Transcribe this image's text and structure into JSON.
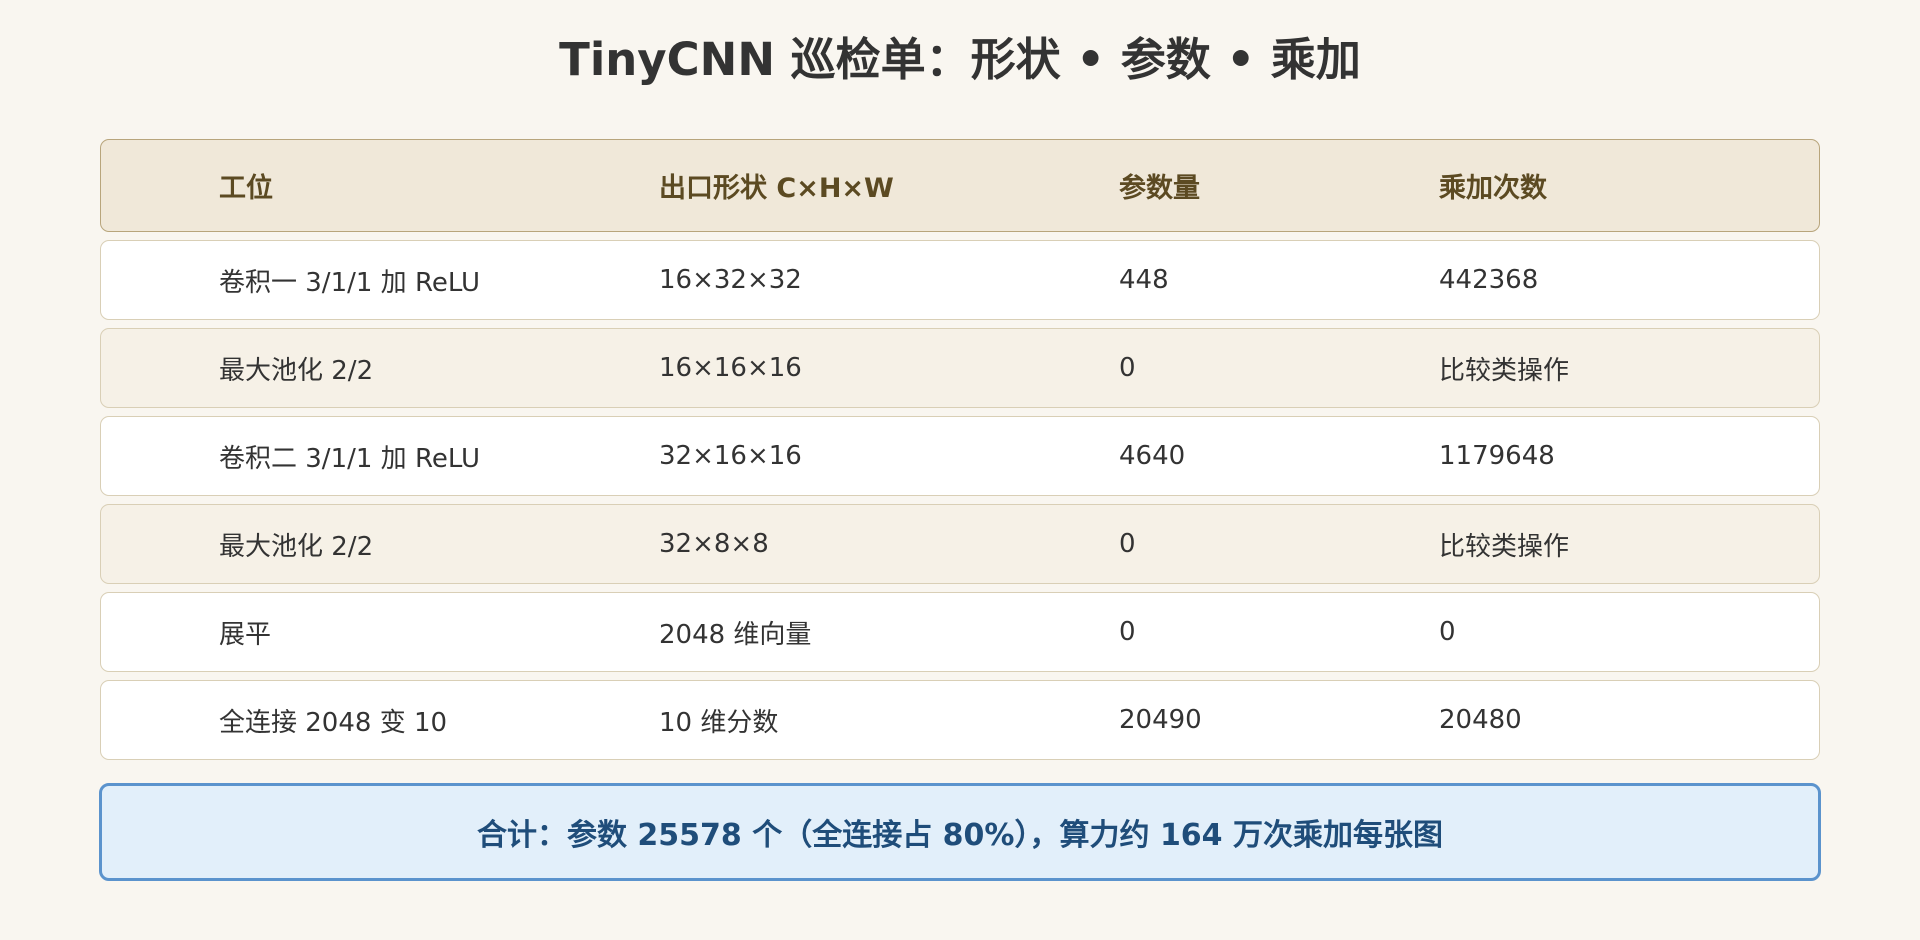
{
  "title": "TinyCNN 巡检单：形状 • 参数 • 乘加",
  "table": {
    "headers": [
      "工位",
      "出口形状 C×H×W",
      "参数量",
      "乘加次数"
    ],
    "rows": [
      [
        "卷积一 3/1/1 加 ReLU",
        "16×32×32",
        "448",
        "442368"
      ],
      [
        "最大池化 2/2",
        "16×16×16",
        "0",
        "比较类操作"
      ],
      [
        "卷积二 3/1/1 加 ReLU",
        "32×16×16",
        "4640",
        "1179648"
      ],
      [
        "最大池化 2/2",
        "32×8×8",
        "0",
        "比较类操作"
      ],
      [
        "展平",
        "2048 维向量",
        "0",
        "0"
      ],
      [
        "全连接 2048 变 10",
        "10 维分数",
        "20490",
        "20480"
      ]
    ]
  },
  "summary": "合计：参数 25578 个（全连接占 80%），算力约 164 万次乘加每张图",
  "colors": {
    "background": "#f9f6f0",
    "header_bg": "#f0e8d9",
    "header_text": "#5c4a22",
    "alt_row_bg": "#f6f1e7",
    "summary_bg": "#e2effa",
    "summary_border": "#5b93cd",
    "summary_text": "#1f4d7a"
  }
}
